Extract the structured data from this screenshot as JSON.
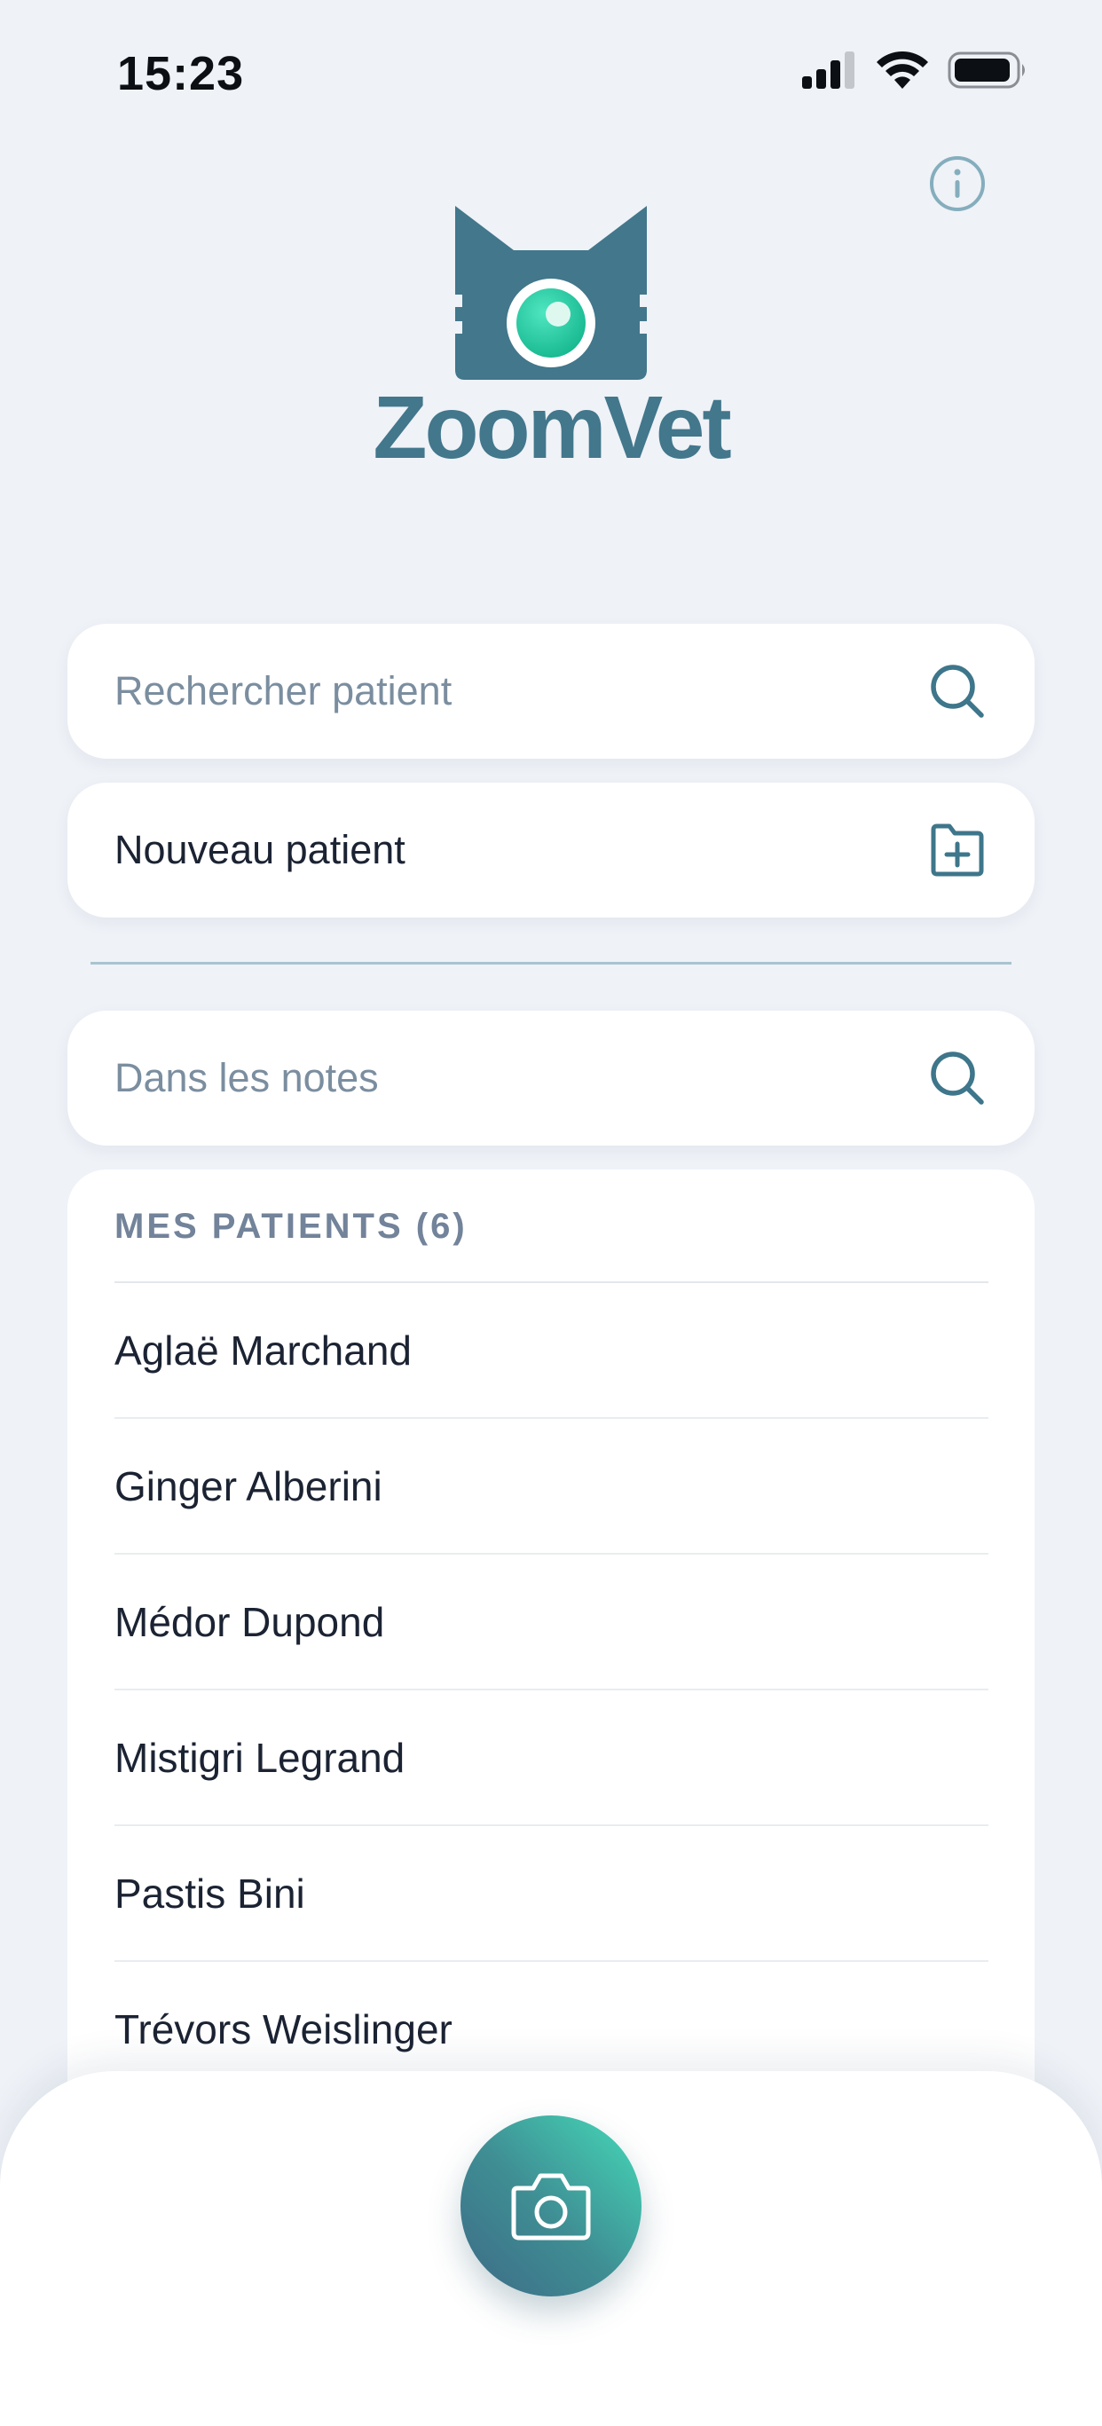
{
  "status_bar": {
    "time": "15:23",
    "icons": [
      "cellular-signal-icon",
      "wifi-icon",
      "battery-icon"
    ]
  },
  "header": {
    "info_icon": "info-icon",
    "logo_text": "ZoomVet",
    "logo_icon": "cat-camera-logo-icon"
  },
  "search": {
    "placeholder": "Rechercher patient",
    "icon": "search-icon"
  },
  "new_patient": {
    "label": "Nouveau patient",
    "icon": "folder-plus-icon"
  },
  "notes_search": {
    "placeholder": "Dans les notes",
    "icon": "search-icon"
  },
  "patients": {
    "header": "MES PATIENTS (6)",
    "items": [
      "Aglaë Marchand",
      "Ginger Alberini",
      "Médor Dupond",
      "Mistigri Legrand",
      "Pastis Bini",
      "Trévors Weislinger"
    ]
  },
  "camera": {
    "icon": "camera-icon"
  },
  "colors": {
    "brand": "#42778c",
    "accent": "#45dbb9",
    "background": "#eff2f7"
  }
}
